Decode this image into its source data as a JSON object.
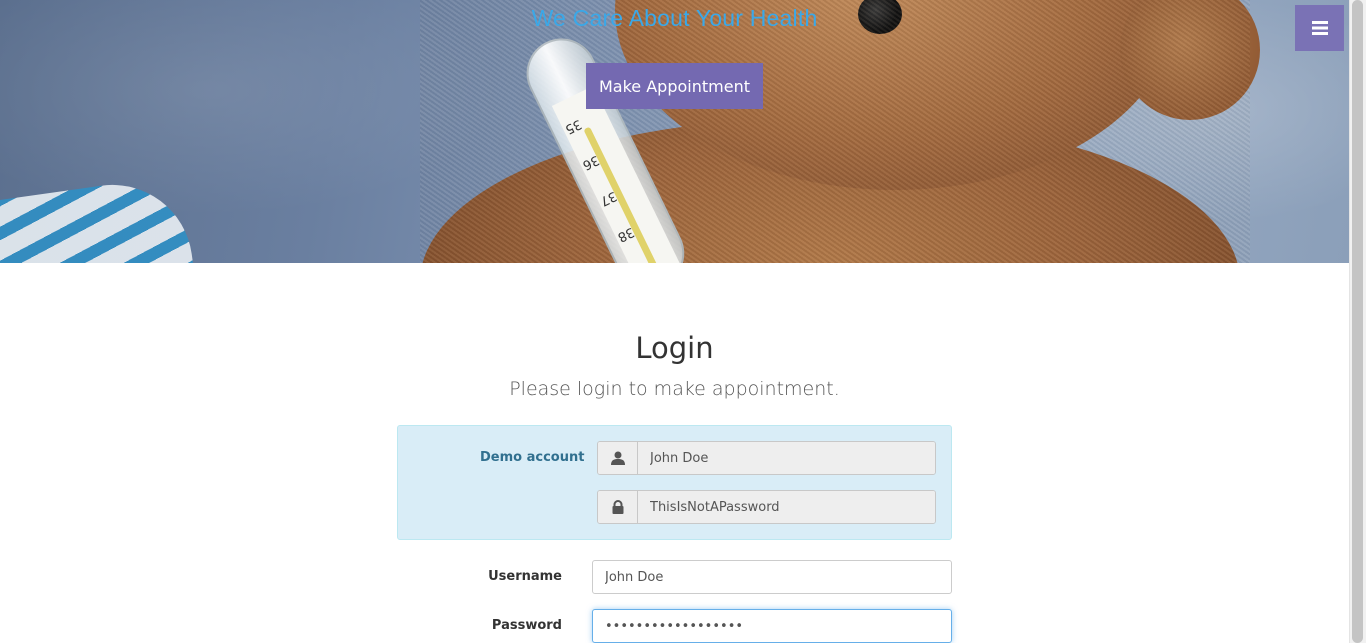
{
  "hero": {
    "title": "We Care About Your Health",
    "appointment_button": "Make Appointment",
    "thermometer_ticks": [
      "35",
      "36",
      "37",
      "38"
    ]
  },
  "nav": {
    "menu_icon": "hamburger-icon"
  },
  "login": {
    "heading": "Login",
    "subheading": "Please login to make appointment.",
    "demo": {
      "label": "Demo account",
      "username": "John Doe",
      "password": "ThisIsNotAPassword",
      "username_icon": "user-icon",
      "password_icon": "lock-icon"
    },
    "username_label": "Username",
    "username_value": "John Doe",
    "password_label": "Password",
    "password_value": "ThisIsNotAPassword"
  },
  "colors": {
    "accent": "#7469b1",
    "title_blue": "#3aa8e8",
    "demo_bg": "#d9edf7",
    "demo_text": "#31708f"
  }
}
